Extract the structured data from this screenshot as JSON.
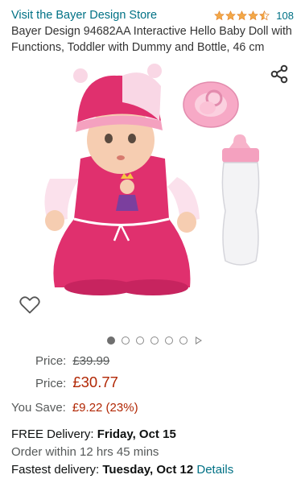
{
  "store_link": "Visit the Bayer Design Store",
  "rating": {
    "stars": 4.5,
    "count": "108",
    "color": "#f3a847"
  },
  "product_title": "Bayer Design 94682AA Interactive Hello Baby Doll with Functions, Toddler with Dummy and Bottle, 46 cm",
  "icons": {
    "share": "share-icon",
    "wishlist": "heart-outline-icon",
    "video": "play-icon"
  },
  "carousel": {
    "total_dots": 6,
    "active_index": 0
  },
  "pricing": {
    "was_label": "Price:",
    "was_price": "£39.99",
    "now_label": "Price:",
    "now_price": "£30.77",
    "save_label": "You Save:",
    "save_value": "£9.22 (23%)"
  },
  "delivery": {
    "free_prefix": "FREE Delivery: ",
    "free_date": "Friday, Oct 15",
    "order_within": "Order within 12 hrs 45 mins",
    "fastest_prefix": "Fastest delivery: ",
    "fastest_date": "Tuesday, Oct 12",
    "details_link": "Details"
  },
  "colors": {
    "link": "#007185",
    "price": "#b12704",
    "muted": "#565959"
  }
}
